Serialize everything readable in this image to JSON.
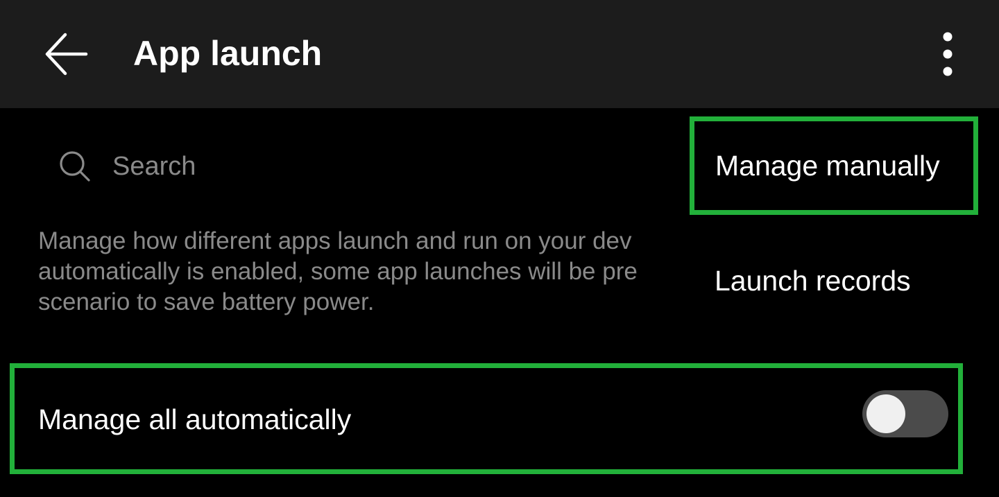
{
  "app_bar": {
    "title": "App launch",
    "back_icon": "arrow-left-icon",
    "more_icon": "more-vertical-icon"
  },
  "search": {
    "placeholder": "Search",
    "value": "",
    "icon": "search-icon"
  },
  "description": {
    "text": "Manage how different apps launch and run on your dev\nautomatically is enabled, some app launches will be pre\nscenario to save battery power."
  },
  "auto_manage": {
    "label": "Manage all automatically",
    "enabled": false
  },
  "menu": {
    "items": [
      {
        "label": "Manage manually"
      },
      {
        "label": "Launch records"
      }
    ]
  },
  "colors": {
    "app_bar_bg": "#1c1c1c",
    "background": "#000000",
    "highlight": "#22b03a",
    "toggle_track_off": "#4b4b4b",
    "secondary_text": "#8a8a8a"
  }
}
